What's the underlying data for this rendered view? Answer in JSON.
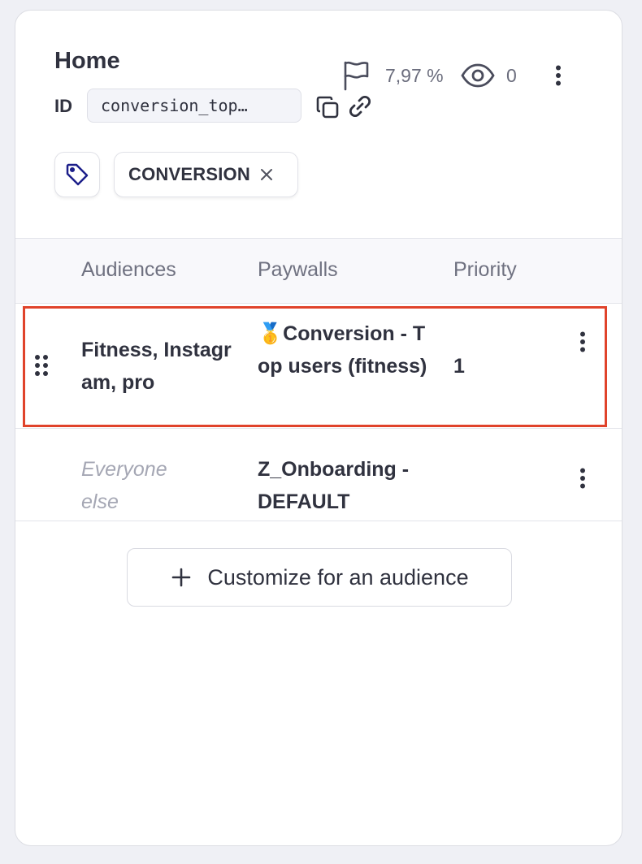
{
  "card": {
    "title": "Home",
    "id_label": "ID",
    "id_value": "conversion_top…",
    "stats": {
      "rate": "7,97 %",
      "views": "0"
    },
    "tag": {
      "label": "CONVERSION"
    }
  },
  "table": {
    "headers": {
      "audiences": "Audiences",
      "paywalls": "Paywalls",
      "priority": "Priority"
    },
    "rows": [
      {
        "audiences": "Fitness, Instagram, pro",
        "paywall_emoji": "🥇",
        "paywall": "Conversion - Top users (fitness)",
        "priority": "1",
        "selected": true
      },
      {
        "audiences": "Everyone else",
        "paywall": "Z_Onboarding - DEFAULT",
        "priority": ""
      }
    ]
  },
  "actions": {
    "customize_label": "Customize for an audience"
  },
  "icons": {
    "copy": "copy-icon",
    "link": "link-icon",
    "flag": "flag-icon",
    "eye": "eye-icon",
    "menu": "more-vertical-icon",
    "tag": "tag-icon",
    "close": "close-icon",
    "drag": "drag-handle-icon",
    "add": "plus-icon"
  },
  "colors": {
    "highlight": "#e0432b",
    "tag_icon": "#1c1f8a",
    "text": "#30323f",
    "muted": "#a5a7b4"
  }
}
